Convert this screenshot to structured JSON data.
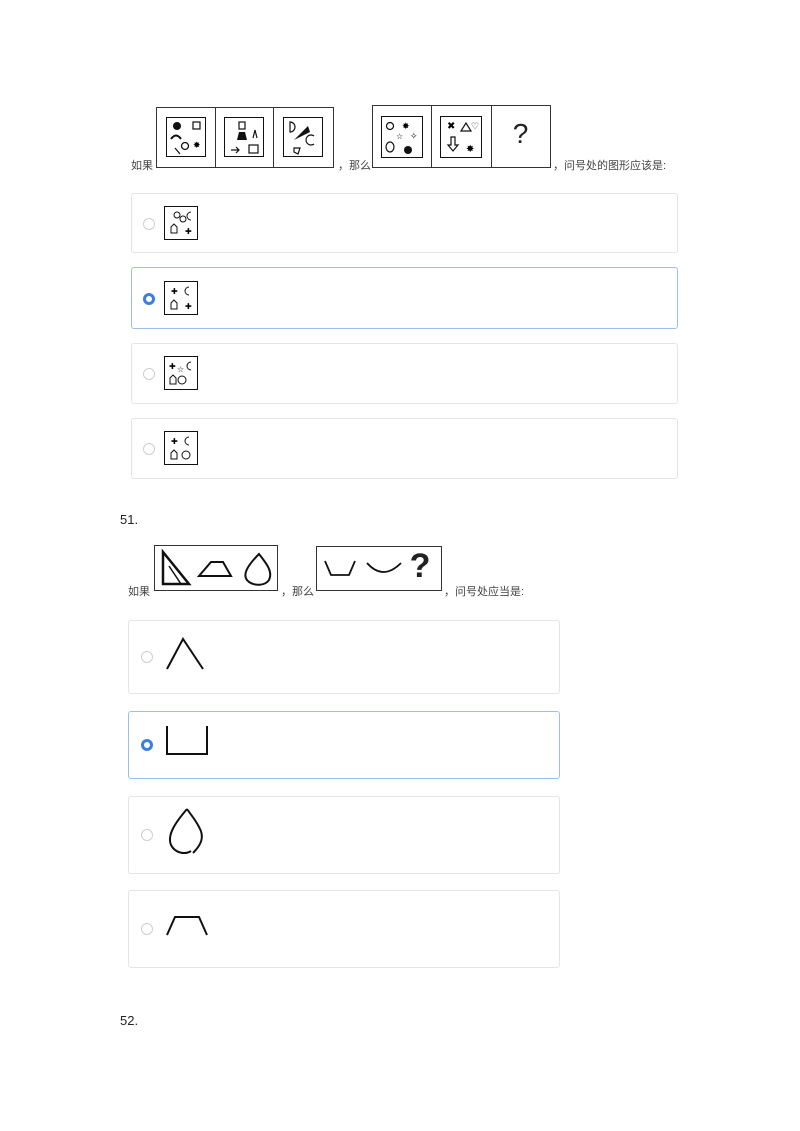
{
  "q50": {
    "prefix": "如果",
    "middle": "，那么",
    "suffix": "，问号处的图形应该是:",
    "question_mark": "?",
    "selected_option": 2
  },
  "q51": {
    "number": "51.",
    "prefix": "如果",
    "middle": "，那么",
    "suffix": "，问号处应当是:",
    "question_mark": "?",
    "selected_option": 2
  },
  "q52": {
    "number": "52."
  },
  "colors": {
    "radio_selected": "#3d7fe0",
    "selected_border": "#9cc0ea",
    "option_border": "#e4e4e4"
  }
}
